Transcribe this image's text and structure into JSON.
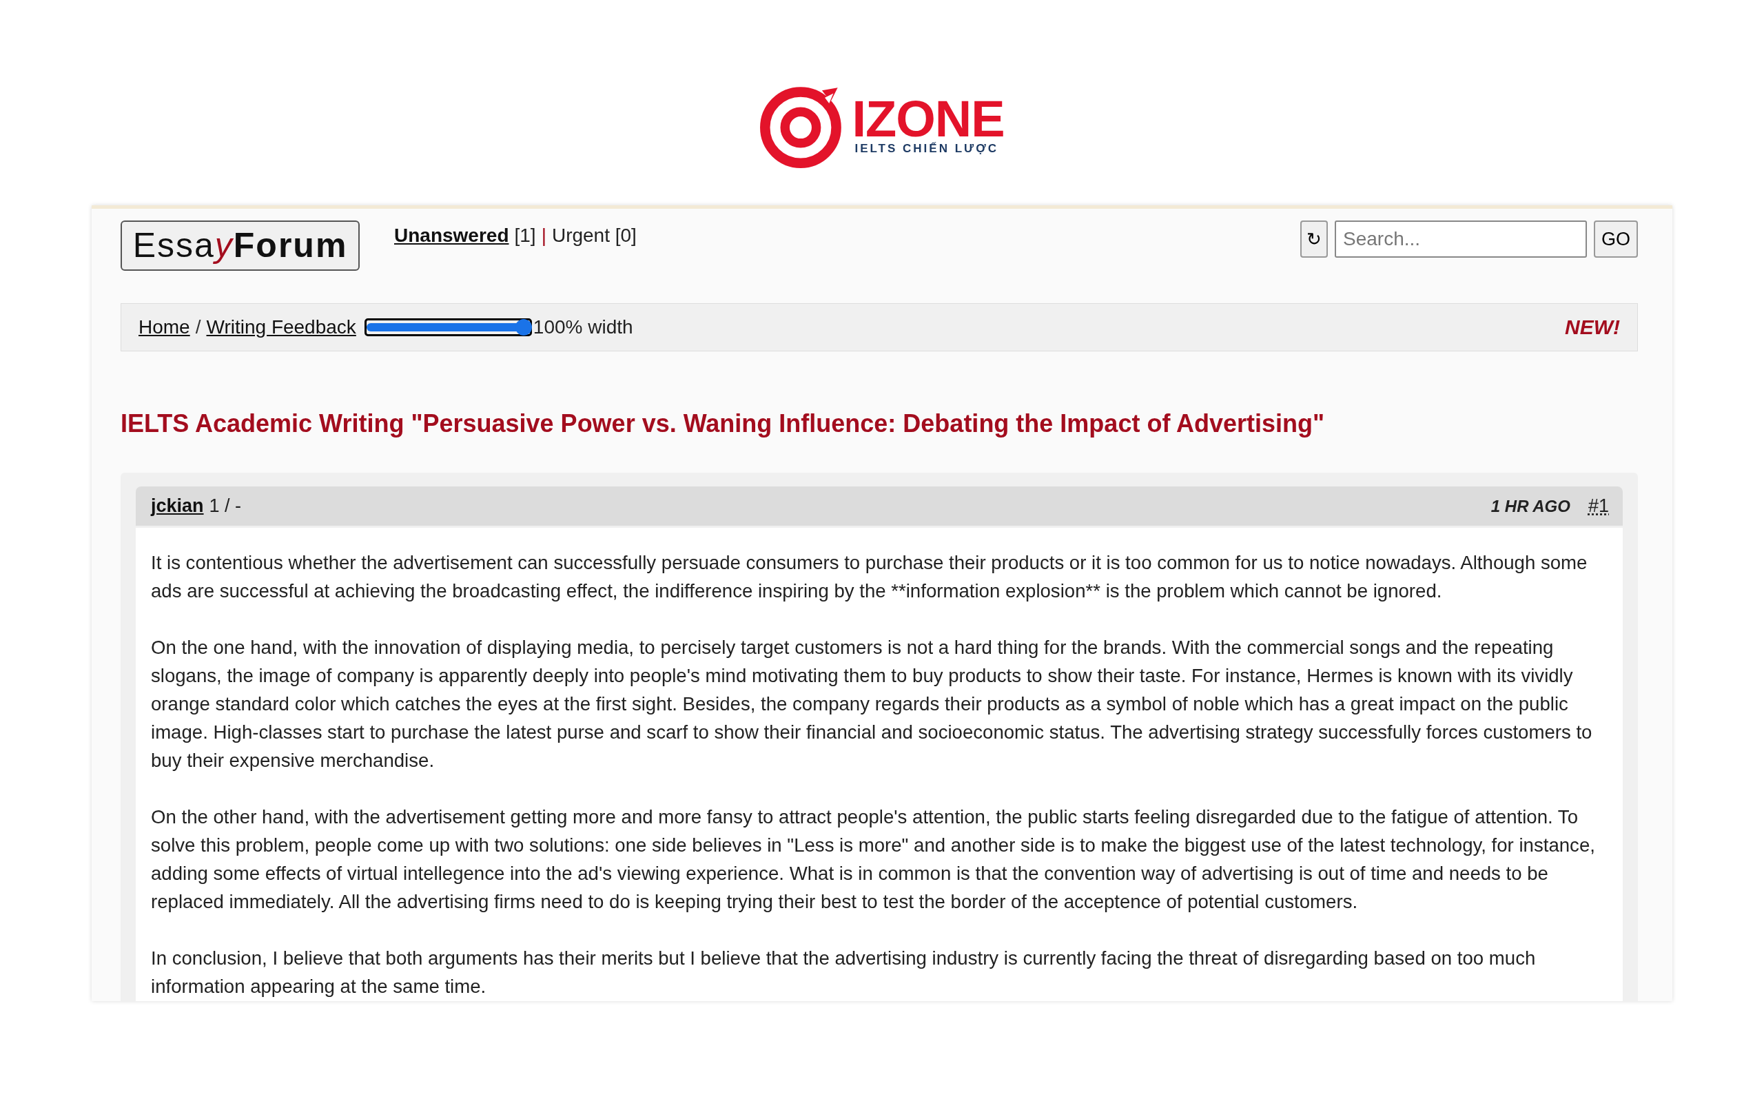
{
  "brand": {
    "name": "IZONE",
    "tagline": "IELTS CHIẾN LƯỢC"
  },
  "site": {
    "logo_parts": [
      {
        "text": "Essa",
        "kind": "plain"
      },
      {
        "text": "y",
        "kind": "accent"
      },
      {
        "text": "Forum",
        "kind": "bold"
      }
    ],
    "nav": [
      {
        "text": "Unanswered",
        "kind": "link"
      },
      {
        "text": "[1]",
        "kind": "text"
      },
      {
        "text": "|",
        "kind": "separator"
      },
      {
        "text": "Urgent [0]",
        "kind": "text"
      }
    ],
    "refresh_button": "↻",
    "search": {
      "placeholder": "Search..."
    },
    "go_button": "GO"
  },
  "breadcrumb": {
    "items": [
      "Home",
      "Writing Feedback"
    ],
    "separator": "/",
    "width_slider": {
      "level": 1.0
    },
    "width_reading": "100% width",
    "badge": "NEW!"
  },
  "title": "IELTS Academic Writing \"Persuasive Power vs. Waning Influence: Debating the Impact of Advertising\"",
  "post": {
    "author": "jckian",
    "author_stats": "1 / -",
    "time": "1 HR AGO",
    "number": "#1",
    "paragraphs": [
      "It is contentious whether the advertisement can successfully persuade consumers to purchase their products or it is too common for us to notice nowadays. Although some ads are successful at achieving the broadcasting effect, the indifference inspiring by the **information explosion** is the problem which cannot be ignored.",
      "On the one hand, with the innovation of displaying media, to percisely target customers is not a hard thing for the brands. With the commercial songs and the repeating slogans, the image of company is apparently deeply into people's mind motivating them to buy products to show their taste. For instance, Hermes is known with its vividly orange standard color which catches the eyes at the first sight. Besides, the company regards their products as a symbol of noble which has a great impact on the public image. High-classes start to purchase the latest purse and scarf to show their financial and socioeconomic status. The advertising strategy successfully forces customers to buy their expensive merchandise.",
      "On the other hand, with the advertisement getting more and more fansy to attract people's attention, the public starts feeling disregarded due to the fatigue of attention. To solve this problem, people come up with two solutions: one side believes in \"Less is more\" and another side is to make the biggest use of the latest technology, for instance, adding some effects of virtual intellegence into the ad's viewing experience. What is in common is that the convention way of advertising is out of time and needs to be replaced immediately. All the advertising firms need to do is keeping trying their best to test the border of the acceptence of potential customers.",
      "In conclusion, I believe that both arguments has their merits but I believe that the advertising industry is currently facing the threat of disregarding based on too much information appearing at the same time."
    ]
  }
}
